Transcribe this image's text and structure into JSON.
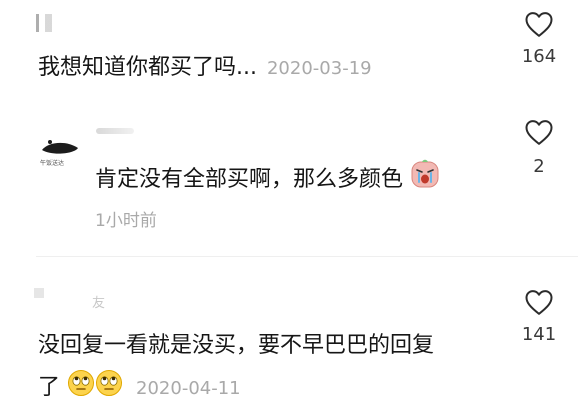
{
  "comments": [
    {
      "username": "I",
      "text": "我想知道你都买了吗...",
      "date": "2020-03-19",
      "likes": "164",
      "avatar_icon": "avatar-blurred-icon",
      "like_icon": "heart-outline-icon"
    },
    {
      "username": "",
      "avatar_label": "午饭送达",
      "text": "肯定没有全部买啊，那么多颜色",
      "emoji_icon": "crying-face-emoji",
      "time": "1小时前",
      "likes": "2",
      "like_icon": "heart-outline-icon"
    },
    {
      "username": "友",
      "text_line1": "没回复一看就是没买，要不早巴巴的回复",
      "text_line2": "了",
      "emoji_icons": [
        "eye-roll-emoji",
        "eye-roll-emoji"
      ],
      "date": "2020-04-11",
      "likes": "141",
      "like_icon": "heart-outline-icon"
    }
  ],
  "colors": {
    "text": "#161616",
    "meta": "#a9a9a9",
    "heart_stroke": "#2b2b2b",
    "divider": "#efefef"
  }
}
